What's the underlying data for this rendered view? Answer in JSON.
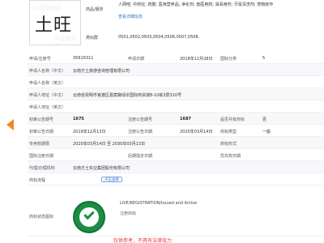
{
  "mark": {
    "logo_text": "土旺",
    "watermark": "中国商标网"
  },
  "top": {
    "goods_label": "商品/服务",
    "goods_value": "人网吧, 中药社; 药膳; 医用营养品; 净化剂; 兽医用药; 消毒用剂; 牙膏清洗剂; 宠物房作",
    "detail_link": "查看详细信息",
    "group_label": "类似群",
    "group_value": "0501,0502,0503,0504,0506,0507,0508,"
  },
  "rows": {
    "reg_no_label": "申请/注册号",
    "reg_no_value": "35616311",
    "apply_date_label": "申请日期",
    "apply_date_value": "2018年12月28日",
    "class_label": "国际分类",
    "class_value": "5",
    "applicant_cn_label": "申请人名称（中文）",
    "applicant_cn_value": "云南方土旅游咨询管理有限公司",
    "applicant_en_label": "申请人名称（英文）",
    "applicant_en_value": "",
    "address_cn_label": "申请人地址（中文）",
    "address_cn_value": "云南省昆明市官渡区嘉宸路绿伞国际商贸城8-10栋3层310号",
    "address_en_label": "申请人地址（英文）",
    "address_en_value": "",
    "prelim_no_label": "初审公告期号",
    "prelim_no_value": "1675",
    "reg_pub_no_label": "注册公告期号",
    "reg_pub_no_value": "1687",
    "shared_label": "是否共有商标",
    "shared_value": "否",
    "prelim_date_label": "初审公告日期",
    "prelim_date_value": "2019年12月13日",
    "reg_pub_date_label": "注册公告日期",
    "reg_pub_date_value": "2020年03月14日",
    "mark_type_label": "商标类型",
    "mark_type_value": "一般",
    "exclusive_label": "专用权期限",
    "exclusive_value": "2020年03月14日 至 2030年03月13日",
    "mark_form_label": "商标形式",
    "mark_form_value": "",
    "intl_reg_date_label": "国际注册日期",
    "intl_reg_date_value": "",
    "later_date_label": "后期指定日期",
    "later_date_value": "",
    "priority_label": "优先权日期",
    "priority_value": "",
    "agent_label": "代理/办理机构",
    "agent_value": "云南方土实业集团股份有限公司",
    "flow_label": "商标流程",
    "flow_button": "点击查看"
  },
  "status": {
    "label": "商标状态图标",
    "text": "LIVE/REGISTRATION/Issued and Active",
    "sub": "注册商标",
    "color": "#1b8d45"
  },
  "footer": {
    "notice": "仅供参考，不具有法律效力"
  }
}
